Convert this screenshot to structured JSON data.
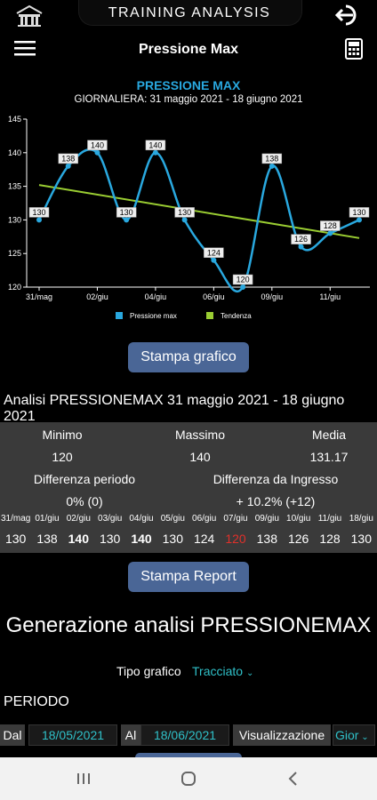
{
  "app": {
    "title": "TRAINING  ANALYSIS",
    "subtitle": "Pressione Max"
  },
  "icons": {
    "home": "home-icon",
    "logout": "logout-icon",
    "menu": "menu-icon",
    "calculator": "calculator-icon"
  },
  "chart_data": {
    "type": "line",
    "title": "PRESSIONE MAX",
    "subtitle": "GIORNALIERA: 31 maggio 2021 - 18 giugno 2021",
    "x": [
      "31/mag",
      "01/giu",
      "02/giu",
      "03/giu",
      "04/giu",
      "05/giu",
      "06/giu",
      "07/giu",
      "09/giu",
      "10/giu",
      "11/giu",
      "18/giu"
    ],
    "tick_labels": [
      "31/mag",
      "02/giu",
      "04/giu",
      "06/giu",
      "09/giu",
      "11/giu"
    ],
    "tick_indices": [
      0,
      2,
      4,
      6,
      8,
      10
    ],
    "yticks": [
      120,
      125,
      130,
      135,
      140,
      145
    ],
    "ylim": [
      120,
      145
    ],
    "series": [
      {
        "name": "Pressione max",
        "color": "#29a8df",
        "values": [
          130,
          138,
          140,
          130,
          140,
          130,
          124,
          120,
          138,
          126,
          128,
          130
        ]
      },
      {
        "name": "Tendenza",
        "color": "#9acd32",
        "values": [
          135.2,
          134.5,
          133.8,
          133.1,
          132.4,
          131.7,
          131.0,
          130.3,
          129.6,
          128.9,
          128.2,
          127.3
        ]
      }
    ],
    "legend": "bottom"
  },
  "buttons": {
    "print_chart": "Stampa grafico",
    "print_report": "Stampa Report"
  },
  "analysis": {
    "title": "Analisi PRESSIONEMAX 31 maggio 2021 - 18 giugno 2021",
    "min_label": "Minimo",
    "max_label": "Massimo",
    "avg_label": "Media",
    "min": "120",
    "max": "140",
    "avg": "131.17",
    "diff_period_label": "Differenza periodo",
    "diff_entry_label": "Differenza da Ingresso",
    "diff_period": "0% (0)",
    "diff_entry": "+ 10.2% (+12)",
    "days": [
      {
        "d": "31/mag",
        "v": "130"
      },
      {
        "d": "01/giu",
        "v": "138"
      },
      {
        "d": "02/giu",
        "v": "140"
      },
      {
        "d": "03/giu",
        "v": "130"
      },
      {
        "d": "04/giu",
        "v": "140"
      },
      {
        "d": "05/giu",
        "v": "130"
      },
      {
        "d": "06/giu",
        "v": "124"
      },
      {
        "d": "07/giu",
        "v": "120"
      },
      {
        "d": "09/giu",
        "v": "138"
      },
      {
        "d": "10/giu",
        "v": "126"
      },
      {
        "d": "11/giu",
        "v": "128"
      },
      {
        "d": "18/giu",
        "v": "130"
      }
    ]
  },
  "generation": {
    "title": "Generazione analisi PRESSIONEMAX",
    "chart_type_label": "Tipo grafico",
    "chart_type_value": "Tracciato",
    "period_label": "PERIODO",
    "from_label": "Dal",
    "from_value": "18/05/2021",
    "to_label": "Al",
    "to_value": "18/06/2021",
    "view_label": "Visualizzazione",
    "view_value": "Gior"
  }
}
